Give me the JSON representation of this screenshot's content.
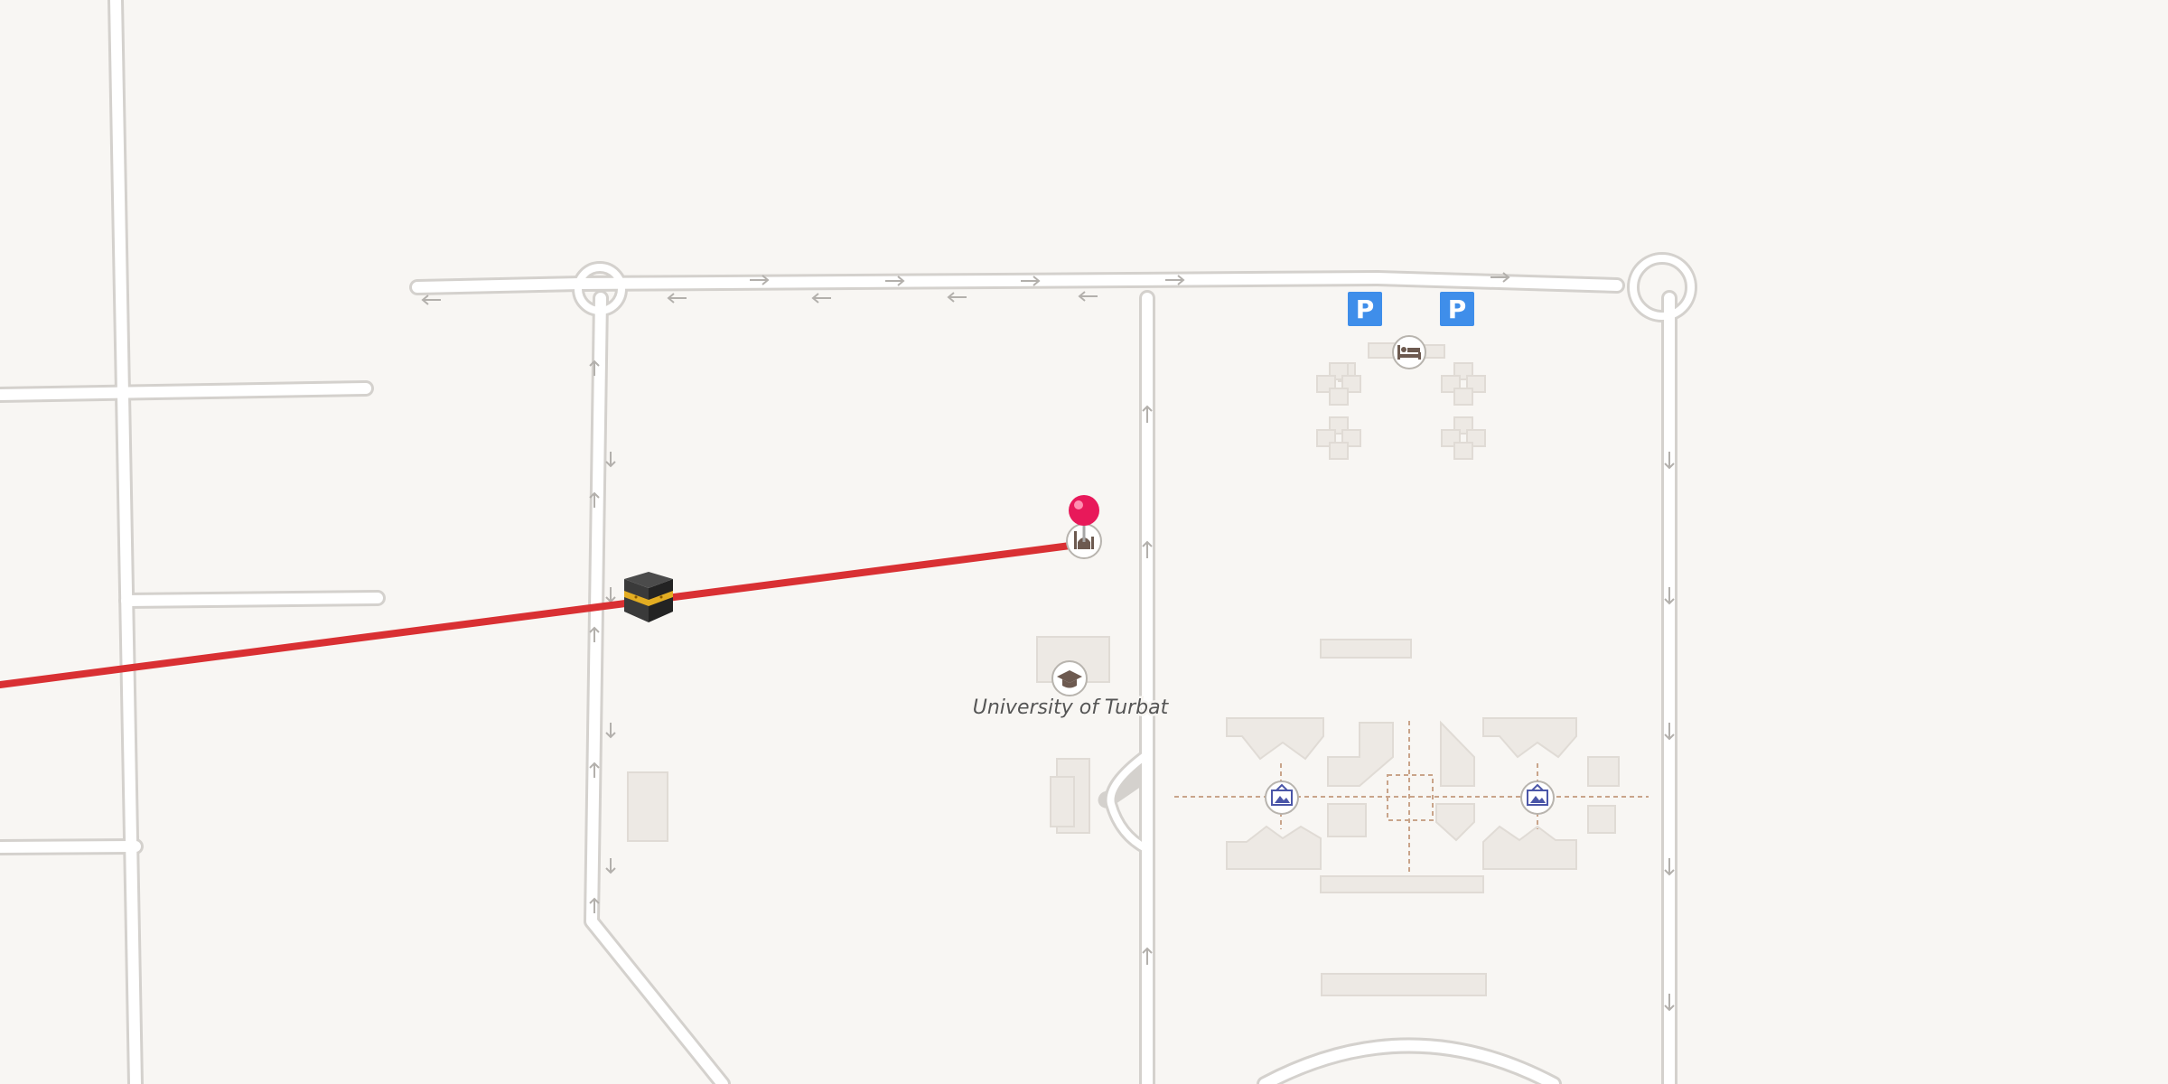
{
  "map": {
    "background_color": "#f8f6f3",
    "road_color": "#ffffff",
    "road_casing_color": "#d4d1cd",
    "building_color": "#ede9e4",
    "route_color": "#d93033",
    "parking_color": "#3f8eea",
    "marker_color": "#e8195a"
  },
  "labels": {
    "campus": "University of Turbat",
    "parking_glyph": "P"
  },
  "pois": [
    {
      "name": "lodging-poi",
      "icon": "bed-icon"
    },
    {
      "name": "mosque-poi",
      "icon": "mosque-icon"
    },
    {
      "name": "university-poi",
      "icon": "graduation-cap-icon"
    },
    {
      "name": "gallery-poi-west",
      "icon": "picture-frame-icon"
    },
    {
      "name": "gallery-poi-east",
      "icon": "picture-frame-icon"
    },
    {
      "name": "parking-west",
      "icon": "parking-icon"
    },
    {
      "name": "parking-east",
      "icon": "parking-icon"
    }
  ],
  "markers": [
    {
      "name": "destination-pin",
      "icon": "map-pin-icon"
    },
    {
      "name": "kaaba-origin",
      "icon": "kaaba-icon"
    }
  ],
  "route": {
    "icon": "qibla-direction-line"
  }
}
